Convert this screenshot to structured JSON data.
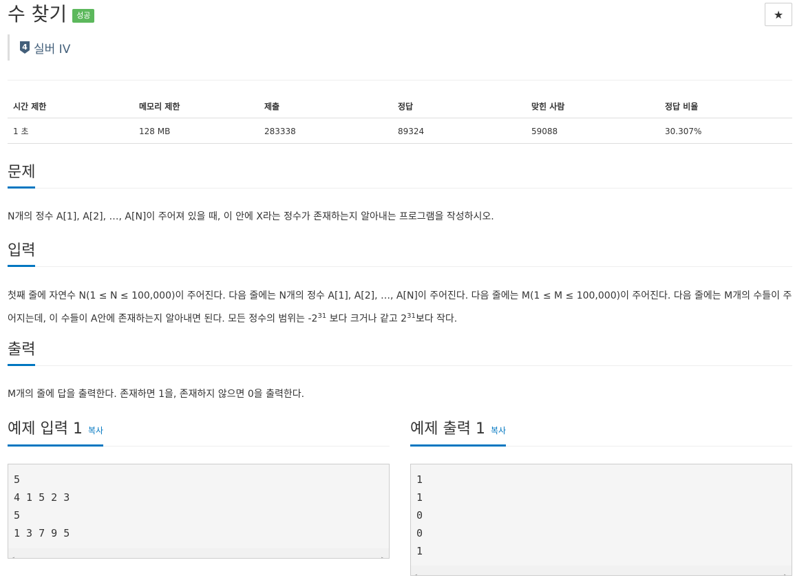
{
  "problem": {
    "title": "수 찾기",
    "result_badge": "성공",
    "star": "★",
    "tier_number": "4",
    "tier_label": "실버 IV"
  },
  "info_table": {
    "headers": [
      "시간 제한",
      "메모리 제한",
      "제출",
      "정답",
      "맞힌 사람",
      "정답 비율"
    ],
    "values": [
      "1 초",
      "128 MB",
      "283338",
      "89324",
      "59088",
      "30.307%"
    ]
  },
  "sections": {
    "description": {
      "heading": "문제",
      "text": "N개의 정수 A[1], A[2], …, A[N]이 주어져 있을 때, 이 안에 X라는 정수가 존재하는지 알아내는 프로그램을 작성하시오."
    },
    "input": {
      "heading": "입력",
      "text_1": "첫째 줄에 자연수 N(1 ≤ N ≤ 100,000)이 주어진다. 다음 줄에는 N개의 정수 A[1], A[2], …, A[N]이 주어진다. 다음 줄에는 M(1 ≤ M ≤ 100,000)이 주어진다. 다음 줄에는 M개의 수들이 주어지는데, 이 수들이 A안에 존재하는지 알아내면 된다. 모든 정수의 범위는 -2",
      "exp_1": "31",
      "text_2": " 보다 크거나 같고 2",
      "exp_2": "31",
      "text_3": "보다 작다."
    },
    "output": {
      "heading": "출력",
      "text": "M개의 줄에 답을 출력한다. 존재하면 1을, 존재하지 않으면 0을 출력한다."
    },
    "sample_input": {
      "heading": "예제 입력 1",
      "copy_label": "복사",
      "content": "5\n4 1 5 2 3\n5\n1 3 7 9 5"
    },
    "sample_output": {
      "heading": "예제 출력 1",
      "copy_label": "복사",
      "content": "1\n1\n0\n0\n1"
    }
  },
  "colors": {
    "accent": "#0076c0",
    "success": "#5cb85c",
    "tier": "#435f7a"
  }
}
